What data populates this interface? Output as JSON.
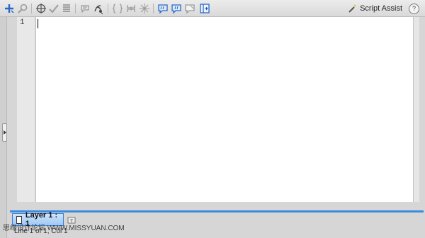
{
  "toolbar": {
    "icons": [
      "add-statement-icon",
      "find-icon",
      "target-icon",
      "check-syntax-icon",
      "auto-format-icon",
      "code-hint-icon",
      "debug-options-icon",
      "collapse-braces-icon",
      "collapse-selection-icon",
      "expand-all-icon",
      "apply-block-comment-icon",
      "apply-line-comment-icon",
      "remove-comment-icon",
      "show-toolbox-icon"
    ],
    "script_assist_label": "Script Assist",
    "help_label": "?"
  },
  "editor": {
    "line_numbers": [
      "1"
    ]
  },
  "tabs": [
    {
      "label": "Layer 1 : 1"
    }
  ],
  "status": {
    "text": "Line 1 of 1, Col 1"
  },
  "watermark": {
    "text": "思缘设计论坛  WWW.MISSYUAN.COM"
  },
  "colors": {
    "accent": "#3d8be0",
    "tab_fill": "#9ec7f2",
    "icon_blue": "#2a68c7"
  }
}
